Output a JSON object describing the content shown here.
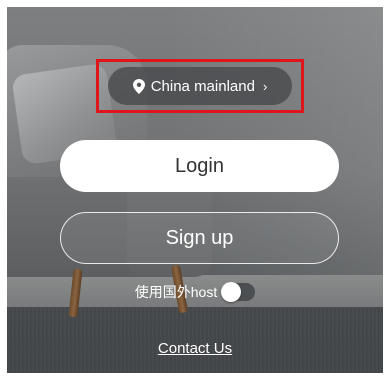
{
  "region": {
    "label": "China mainland",
    "icon": "location-pin-icon",
    "chevron": "›"
  },
  "buttons": {
    "login_label": "Login",
    "signup_label": "Sign up"
  },
  "host_toggle": {
    "label": "使用国外host",
    "enabled": false
  },
  "footer": {
    "contact_label": "Contact Us"
  },
  "colors": {
    "highlight": "#e0151c",
    "login_bg": "#ffffff",
    "text_light": "#ffffff"
  }
}
